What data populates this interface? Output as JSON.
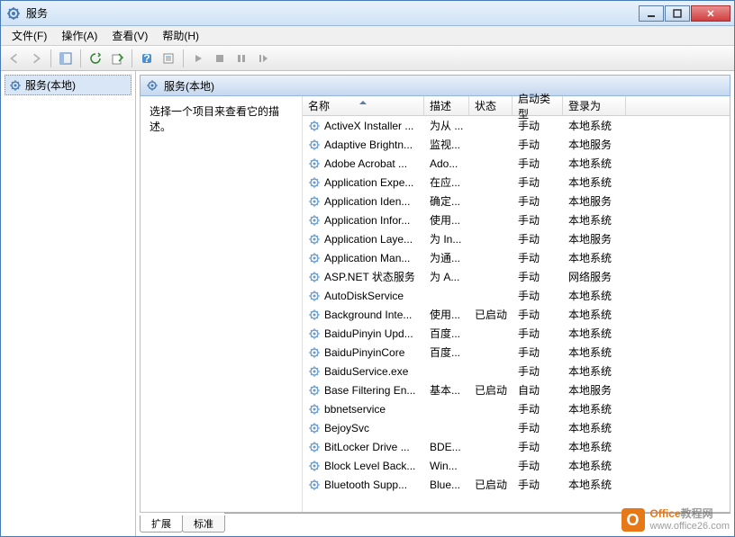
{
  "window": {
    "title": "服务"
  },
  "menu": {
    "file": "文件(F)",
    "action": "操作(A)",
    "view": "查看(V)",
    "help": "帮助(H)"
  },
  "tree": {
    "root": "服务(本地)"
  },
  "pane": {
    "header": "服务(本地)"
  },
  "desc": {
    "prompt": "选择一个项目来查看它的描述。"
  },
  "columns": {
    "name": "名称",
    "desc": "描述",
    "status": "状态",
    "start": "启动类型",
    "logon": "登录为"
  },
  "tabs": {
    "extended": "扩展",
    "standard": "标准"
  },
  "services": [
    {
      "name": "ActiveX Installer ...",
      "desc": "为从 ...",
      "status": "",
      "start": "手动",
      "logon": "本地系统"
    },
    {
      "name": "Adaptive Brightn...",
      "desc": "监视...",
      "status": "",
      "start": "手动",
      "logon": "本地服务"
    },
    {
      "name": "Adobe Acrobat ...",
      "desc": "Ado...",
      "status": "",
      "start": "手动",
      "logon": "本地系统"
    },
    {
      "name": "Application Expe...",
      "desc": "在应...",
      "status": "",
      "start": "手动",
      "logon": "本地系统"
    },
    {
      "name": "Application Iden...",
      "desc": "确定...",
      "status": "",
      "start": "手动",
      "logon": "本地服务"
    },
    {
      "name": "Application Infor...",
      "desc": "使用...",
      "status": "",
      "start": "手动",
      "logon": "本地系统"
    },
    {
      "name": "Application Laye...",
      "desc": "为 In...",
      "status": "",
      "start": "手动",
      "logon": "本地服务"
    },
    {
      "name": "Application Man...",
      "desc": "为通...",
      "status": "",
      "start": "手动",
      "logon": "本地系统"
    },
    {
      "name": "ASP.NET 状态服务",
      "desc": "为 A...",
      "status": "",
      "start": "手动",
      "logon": "网络服务"
    },
    {
      "name": "AutoDiskService",
      "desc": "",
      "status": "",
      "start": "手动",
      "logon": "本地系统"
    },
    {
      "name": "Background Inte...",
      "desc": "使用...",
      "status": "已启动",
      "start": "手动",
      "logon": "本地系统"
    },
    {
      "name": "BaiduPinyin Upd...",
      "desc": "百度...",
      "status": "",
      "start": "手动",
      "logon": "本地系统"
    },
    {
      "name": "BaiduPinyinCore",
      "desc": "百度...",
      "status": "",
      "start": "手动",
      "logon": "本地系统"
    },
    {
      "name": "BaiduService.exe",
      "desc": "",
      "status": "",
      "start": "手动",
      "logon": "本地系统"
    },
    {
      "name": "Base Filtering En...",
      "desc": "基本...",
      "status": "已启动",
      "start": "自动",
      "logon": "本地服务"
    },
    {
      "name": "bbnetservice",
      "desc": "",
      "status": "",
      "start": "手动",
      "logon": "本地系统"
    },
    {
      "name": "BejoySvc",
      "desc": "",
      "status": "",
      "start": "手动",
      "logon": "本地系统"
    },
    {
      "name": "BitLocker Drive ...",
      "desc": "BDE...",
      "status": "",
      "start": "手动",
      "logon": "本地系统"
    },
    {
      "name": "Block Level Back...",
      "desc": "Win...",
      "status": "",
      "start": "手动",
      "logon": "本地系统"
    },
    {
      "name": "Bluetooth Supp...",
      "desc": "Blue...",
      "status": "已启动",
      "start": "手动",
      "logon": "本地系统"
    }
  ],
  "watermark": {
    "line1a": "Office",
    "line1b": "教程网",
    "line2": "www.office26.com"
  }
}
